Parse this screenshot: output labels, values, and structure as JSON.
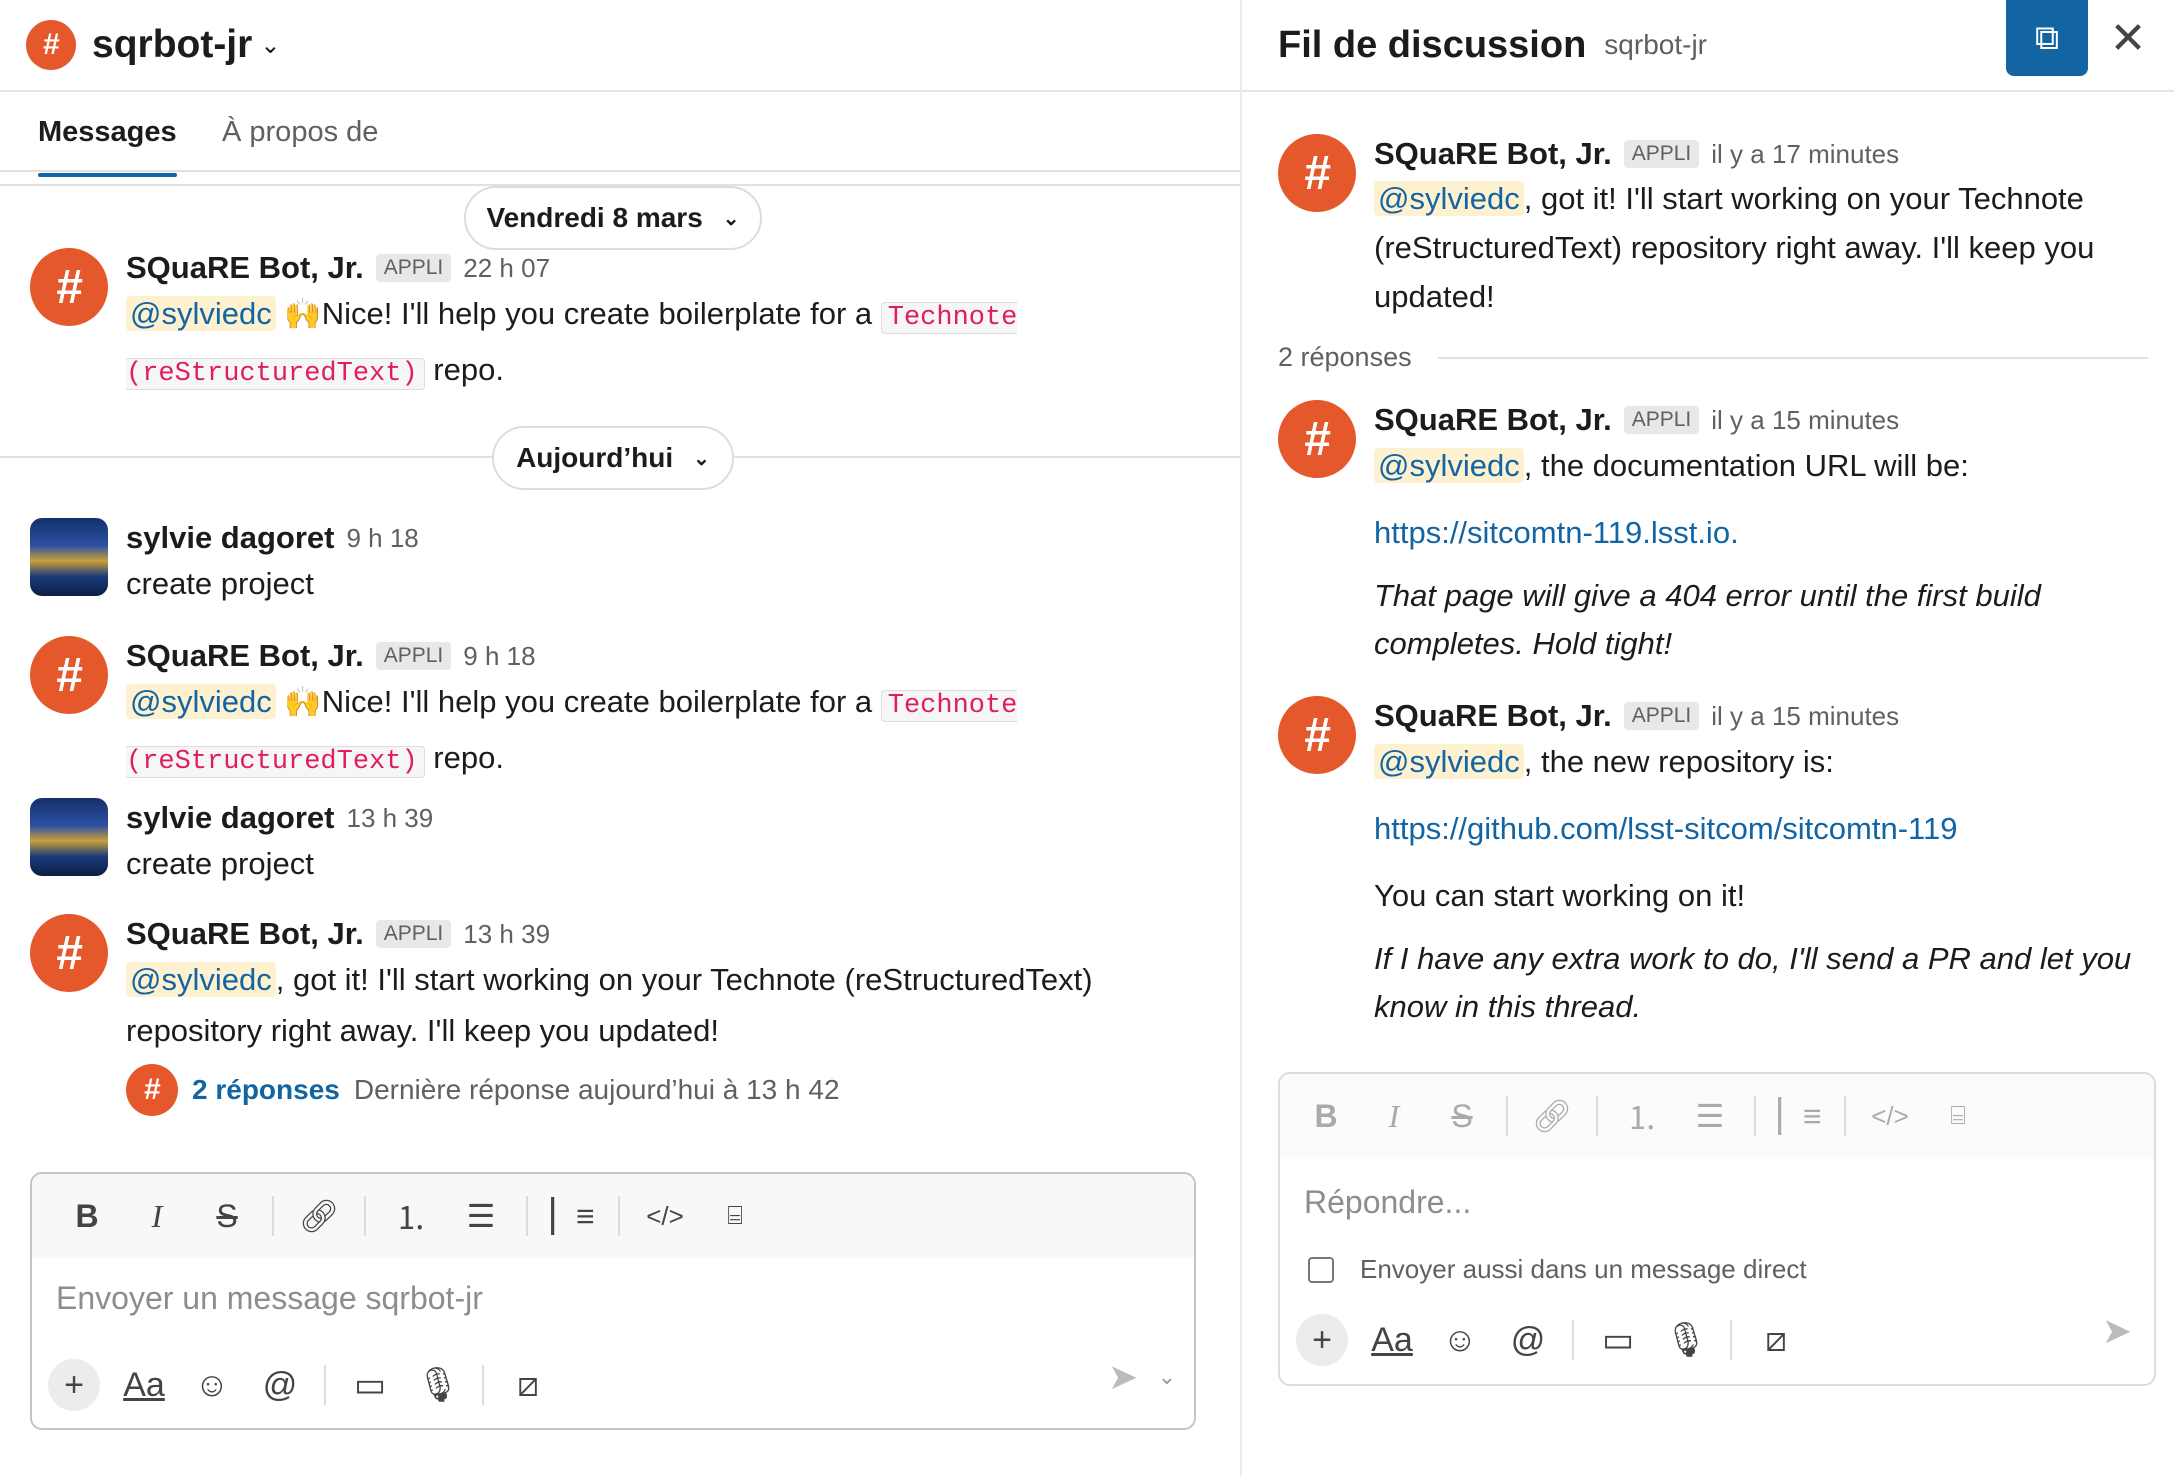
{
  "channel": {
    "name": "sqrbot-jr"
  },
  "tabs": [
    "Messages",
    "À propos de"
  ],
  "dates": {
    "friday": "Vendredi 8 mars",
    "today": "Aujourd’hui"
  },
  "messages": [
    {
      "sender": "SQuaRE Bot, Jr.",
      "badge": "APPLI",
      "time": "22 h 07",
      "mention": "@sylviedc",
      "emoji": "🙌",
      "text_before": "Nice! I'll help you create boilerplate for a ",
      "code": "Technote (reStructuredText)",
      "text_after": " repo."
    },
    {
      "sender": "sylvie dagoret",
      "time": "9 h 18",
      "text": "create project"
    },
    {
      "sender": "SQuaRE Bot, Jr.",
      "badge": "APPLI",
      "time": "9 h 18",
      "mention": "@sylviedc",
      "emoji": "🙌",
      "text_before": "Nice! I'll help you create boilerplate for a ",
      "code": "Technote (reStructuredText)",
      "text_after": " repo."
    },
    {
      "sender": "sylvie dagoret",
      "time": "13 h 39",
      "text": "create project"
    },
    {
      "sender": "SQuaRE Bot, Jr.",
      "badge": "APPLI",
      "time": "13 h 39",
      "mention": "@sylviedc",
      "text": ", got it! I'll start working on your Technote (reStructuredText) repository right away. I'll keep you updated!",
      "replies_label": "2 réponses",
      "replies_meta": "Dernière réponse aujourd’hui à 13 h 42"
    }
  ],
  "composer": {
    "placeholder": "Envoyer un message sqrbot-jr"
  },
  "thread": {
    "title": "Fil de discussion",
    "channel": "sqrbot-jr",
    "parent": {
      "sender": "SQuaRE Bot, Jr.",
      "badge": "APPLI",
      "time": "il y a 17 minutes",
      "mention": "@sylviedc",
      "text": ", got it! I'll start working on your Technote (reStructuredText) repository right away. I'll keep you updated!"
    },
    "reply_count": "2 réponses",
    "replies": [
      {
        "sender": "SQuaRE Bot, Jr.",
        "badge": "APPLI",
        "time": "il y a 15 minutes",
        "mention": "@sylviedc",
        "text": ", the documentation URL will be:",
        "link": "https://sitcomtn-119.lsst.io",
        "link_suffix": ".",
        "note": "That page will give a 404 error until the first build completes. Hold tight!"
      },
      {
        "sender": "SQuaRE Bot, Jr.",
        "badge": "APPLI",
        "time": "il y a 15 minutes",
        "mention": "@sylviedc",
        "text": ", the new repository is:",
        "link": "https://github.com/lsst-sitcom/sitcomtn-119",
        "plain": "You can start working on it!",
        "note": "If I have any extra work to do, I'll send a PR and let you know in this thread."
      }
    ],
    "composer": {
      "placeholder": "Répondre...",
      "also_send": "Envoyer aussi dans un message direct"
    }
  },
  "colors": {
    "accent": "#1264a3",
    "bot": "#e4582b",
    "mention_bg": "#fdf1d0",
    "code": "#e01e5a"
  }
}
